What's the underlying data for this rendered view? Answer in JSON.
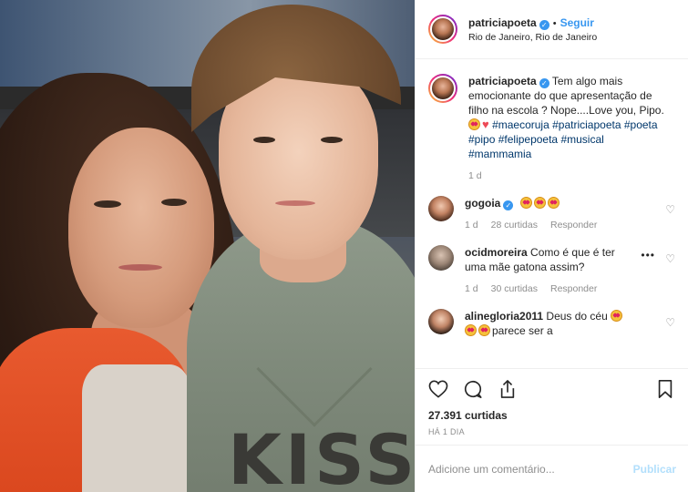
{
  "header": {
    "username": "patriciapoeta",
    "separator": "•",
    "follow_label": "Seguir",
    "location": "Rio de Janeiro, Rio de Janeiro"
  },
  "caption": {
    "username": "patriciapoeta",
    "text": "Tem algo mais emocionante do que apresentação de filho na escola ? Nope....Love you, Pipo.",
    "hashtags": [
      "#maecoruja",
      "#patriciapoeta",
      "#poeta",
      "#pipo",
      "#felipepoeta",
      "#musical",
      "#mammamia"
    ],
    "time": "1 d"
  },
  "comments": [
    {
      "username": "gogoia",
      "verified": true,
      "text": "",
      "emoji_count": 3,
      "time": "1 d",
      "likes": "28 curtidas",
      "reply": "Responder"
    },
    {
      "username": "ocidmoreira",
      "verified": false,
      "text": "Como é que é ter uma mãe gatona assim?",
      "time": "1 d",
      "likes": "30 curtidas",
      "reply": "Responder",
      "more": "•••"
    },
    {
      "username": "alinegloria2011",
      "verified": false,
      "text": "Deus do céu",
      "text2": "parece ser a"
    }
  ],
  "footer": {
    "likes": "27.391 curtidas",
    "time_ago": "HÁ 1 DIA",
    "comment_placeholder": "Adicione um comentário...",
    "publish_label": "Publicar"
  },
  "photo": {
    "shirt_text": "KISS"
  },
  "icons": {
    "like": "heart-outline-icon",
    "comment": "comment-bubble-icon",
    "share": "share-icon",
    "save": "bookmark-icon"
  },
  "colors": {
    "link": "#3897f0",
    "hashtag": "#00376b",
    "muted": "#8e8e8e",
    "publish_disabled": "#b2dffc"
  }
}
